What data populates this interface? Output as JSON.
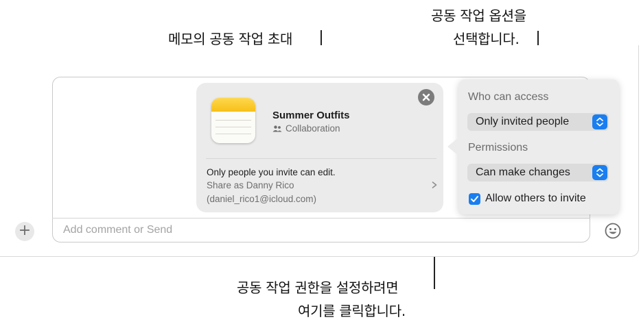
{
  "callouts": {
    "invite": "메모의 공동 작업 초대",
    "options_line1": "공동 작업 옵션을",
    "options_line2": "선택합니다.",
    "permissions_line1": "공동 작업 권한을 설정하려면",
    "permissions_line2": "여기를 클릭합니다."
  },
  "card": {
    "note_title": "Summer Outfits",
    "collab_label": "Collaboration",
    "access_text": "Only people you invite can edit.",
    "share_as": "Share as Danny Rico",
    "email": "(daniel_rico1@icloud.com)"
  },
  "popover": {
    "who_label": "Who can access",
    "who_value": "Only invited people",
    "permissions_label": "Permissions",
    "permissions_value": "Can make changes",
    "allow_invite_label": "Allow others to invite",
    "allow_invite_checked": true
  },
  "compose": {
    "placeholder": "Add comment or Send"
  },
  "icons": {
    "plus": "plus-icon",
    "emoji": "emoji-icon",
    "close": "close-icon",
    "people": "people-icon",
    "chevron": "chevron-right-icon",
    "stepper": "stepper-icon",
    "check": "checkmark-icon",
    "notes": "notes-app-icon"
  },
  "colors": {
    "accent": "#1a7ef0",
    "card_bg": "#ebebeb",
    "popover_bg": "#ececec",
    "notes_yellow": "#f6c018"
  }
}
